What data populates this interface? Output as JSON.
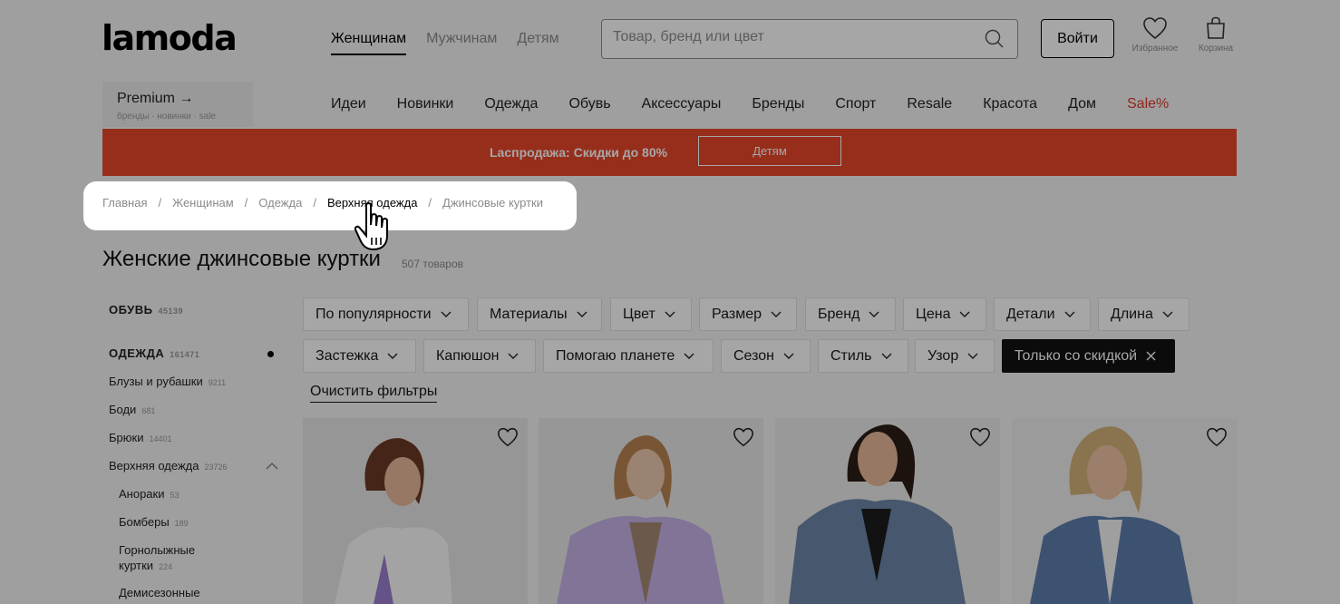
{
  "header": {
    "logo": "lamoda",
    "gender_tabs": [
      {
        "label": "Женщинам",
        "active": true
      },
      {
        "label": "Мужчинам",
        "active": false
      },
      {
        "label": "Детям",
        "active": false
      }
    ],
    "search_placeholder": "Товар, бренд или цвет",
    "search_icon": "search-icon",
    "login_label": "Войти",
    "favorites_label": "Избранное",
    "cart_label": "Корзина",
    "premium": {
      "title": "Premium →",
      "subtitle": "бренды · новинки · sale"
    },
    "categories": [
      "Идеи",
      "Новинки",
      "Одежда",
      "Обувь",
      "Аксессуары",
      "Бренды",
      "Спорт",
      "Resale",
      "Красота",
      "Дом",
      "Sale%"
    ],
    "sale_color": "#e03a2b"
  },
  "banner": {
    "text": "Laспродажа: Скидки до 80%",
    "button": "Детям",
    "color": "#e8482b"
  },
  "breadcrumb": [
    "Главная",
    "Женщинам",
    "Одежда",
    "Верхняя одежда",
    "Джинсовые куртки"
  ],
  "page": {
    "title": "Женские джинсовые куртки",
    "count": "507 товаров"
  },
  "sidebar": {
    "items": [
      {
        "label": "ОБУВЬ",
        "count": "45139"
      },
      {
        "label": "ОДЕЖДА",
        "count": "161471"
      },
      {
        "label": "Блузы и рубашки",
        "count": "9211"
      },
      {
        "label": "Боди",
        "count": "681"
      },
      {
        "label": "Брюки",
        "count": "14401"
      },
      {
        "label": "Верхняя одежда",
        "count": "23726"
      },
      {
        "label": "Анораки",
        "count": "53"
      },
      {
        "label": "Бомберы",
        "count": "189"
      },
      {
        "label": "Горнолыжные",
        "count": ""
      },
      {
        "label": "куртки",
        "count": "224"
      },
      {
        "label": "Демисезонные",
        "count": ""
      }
    ]
  },
  "filters": {
    "row1": [
      "По популярности",
      "Материалы",
      "Цвет",
      "Размер",
      "Бренд",
      "Цена",
      "Детали",
      "Длина"
    ],
    "row2": [
      "Застежка",
      "Капюшон",
      "Помогаю планете",
      "Сезон",
      "Стиль",
      "Узор"
    ],
    "active": "Только со скидкой",
    "clear": "Очистить фильтры"
  },
  "products": [
    {
      "alt": "white denim jacket"
    },
    {
      "alt": "lilac denim jacket"
    },
    {
      "alt": "blue denim jacket"
    },
    {
      "alt": "blue denim jacket"
    }
  ]
}
